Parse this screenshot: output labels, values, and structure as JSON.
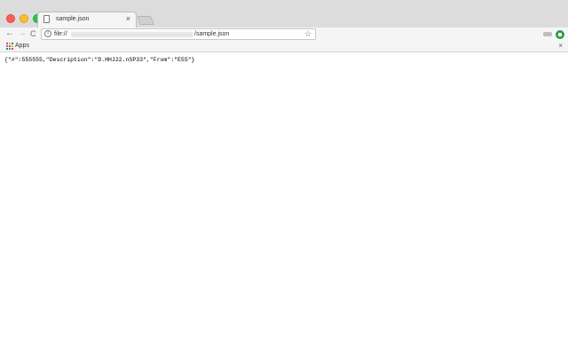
{
  "tab": {
    "title": "sample.json",
    "close_glyph": "×",
    "icon": "page-icon"
  },
  "toolbar": {
    "back_glyph": "←",
    "forward_glyph": "→",
    "reload_glyph": "C",
    "info_glyph": "i",
    "url_prefix": "file://",
    "url_suffix": "/sample.json",
    "star_glyph": "☆"
  },
  "bookmarks": {
    "apps_label": "Apps",
    "close_glyph": "×"
  },
  "content": {
    "json_text": "{\"#\":555555,\"Description\":\"D.HHJ22.nSP33\",\"From\":\"E55\"}"
  },
  "colors": {
    "traffic_red": "#fc5f57",
    "traffic_yellow": "#fdbc2e",
    "traffic_green": "#28c840",
    "extension_green": "#2f9e44"
  }
}
